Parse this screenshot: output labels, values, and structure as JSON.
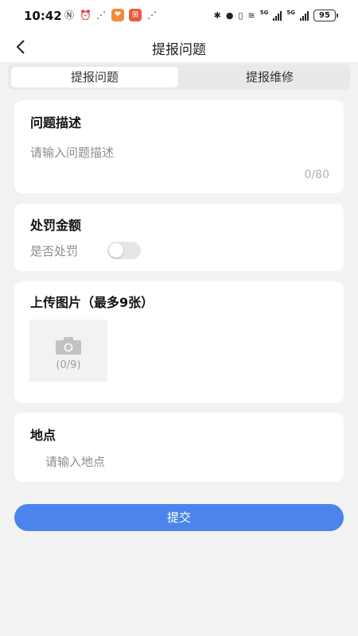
{
  "status_bar": {
    "time": "10:42",
    "battery": "95",
    "network": "5G"
  },
  "nav": {
    "title": "提报问题",
    "back_icon": "chevron-left-icon"
  },
  "tabs": [
    {
      "label": "提报问题",
      "active": true
    },
    {
      "label": "提报维修",
      "active": false
    }
  ],
  "description": {
    "title": "问题描述",
    "placeholder": "请输入问题描述",
    "counter": "0/80"
  },
  "penalty": {
    "title": "处罚金额",
    "toggle_label": "是否处罚",
    "toggle_on": false
  },
  "upload": {
    "title": "上传图片（最多9张）",
    "count": "(0/9)",
    "icon": "camera-icon"
  },
  "location": {
    "title": "地点",
    "placeholder": "请输入地点"
  },
  "submit_label": "提交",
  "colors": {
    "accent": "#4b85ec",
    "background": "#f2f2f2"
  }
}
